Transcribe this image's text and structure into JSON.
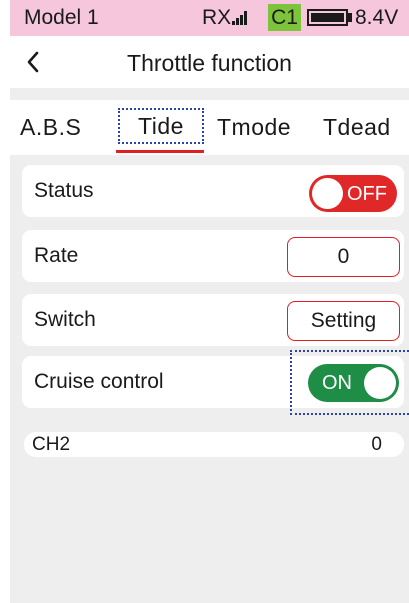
{
  "status_bar": {
    "model_name": "Model 1",
    "rx_label": "RX",
    "signal_icon": "signal-bars-icon",
    "channel_badge": "C1",
    "battery_icon": "battery-icon",
    "voltage": "8.4V"
  },
  "title_bar": {
    "back_icon": "chevron-left-icon",
    "title": "Throttle function"
  },
  "tabs": [
    {
      "label": "A.B.S"
    },
    {
      "label": "Tide",
      "selected": true
    },
    {
      "label": "Tmode"
    },
    {
      "label": "Tdead"
    }
  ],
  "rows": {
    "status": {
      "label": "Status",
      "toggle_text": "OFF"
    },
    "rate": {
      "label": "Rate",
      "value": "0"
    },
    "switch": {
      "label": "Switch",
      "value": "Setting"
    },
    "cruise": {
      "label": "Cruise control",
      "toggle_text": "ON"
    }
  },
  "channel": {
    "label": "CH2",
    "value": "0"
  },
  "colors": {
    "status_bar_bg": "#f6c6dc",
    "channel_badge_bg": "#7dc43c",
    "toggle_off": "#e02828",
    "toggle_on": "#1e8d45",
    "accent_red": "#e02020",
    "focus_blue": "#2a44a8"
  }
}
